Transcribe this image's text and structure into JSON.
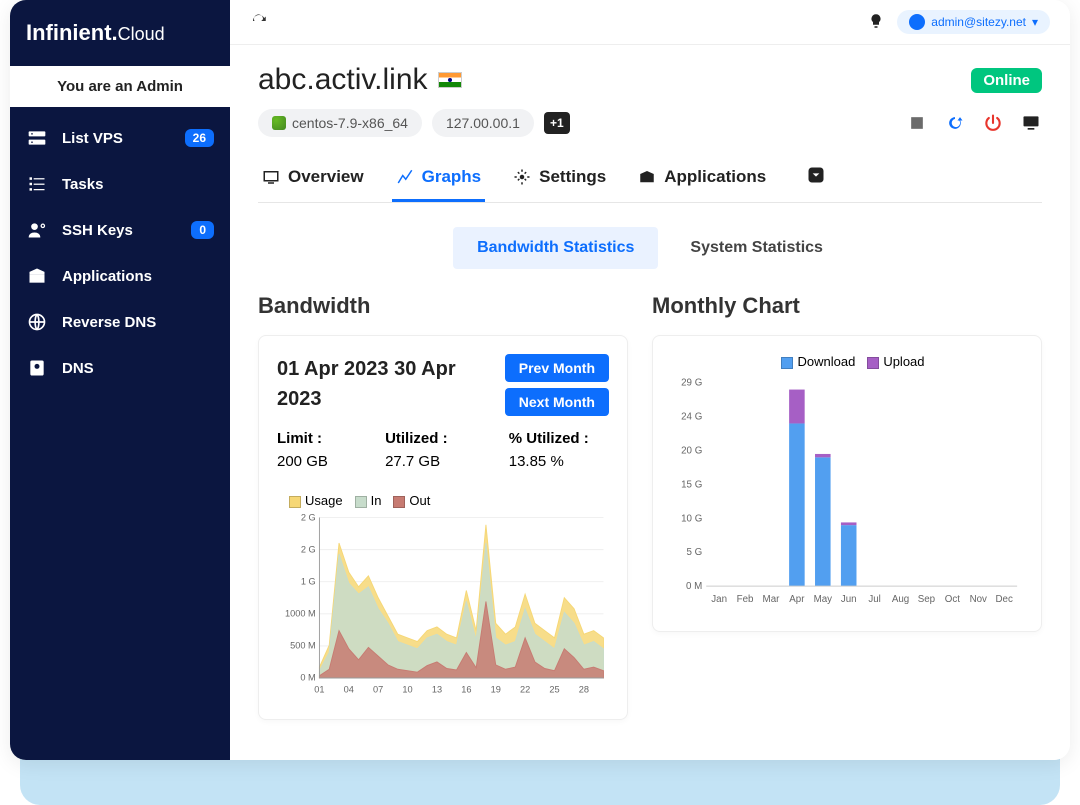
{
  "brand": {
    "main": "Infinient.",
    "sub": "Cloud"
  },
  "admin_banner": "You are an Admin",
  "sidebar": [
    {
      "label": "List VPS",
      "badge": "26"
    },
    {
      "label": "Tasks",
      "badge": null
    },
    {
      "label": "SSH Keys",
      "badge": "0"
    },
    {
      "label": "Applications",
      "badge": null
    },
    {
      "label": "Reverse DNS",
      "badge": null
    },
    {
      "label": "DNS",
      "badge": null
    }
  ],
  "user": "admin@sitezy.net",
  "vps": {
    "title": "abc.activ.link",
    "status": "Online",
    "os": "centos-7.9-x86_64",
    "ip": "127.00.00.1",
    "more_ips": "+1"
  },
  "tabs": [
    "Overview",
    "Graphs",
    "Settings",
    "Applications"
  ],
  "subtabs": [
    "Bandwidth Statistics",
    "System Statistics"
  ],
  "bandwidth": {
    "title": "Bandwidth",
    "period": "01 Apr 2023  30 Apr 2023",
    "prev_btn": "Prev Month",
    "next_btn": "Next Month",
    "limit_label": "Limit :",
    "limit_val": "200 GB",
    "util_label": "Utilized :",
    "util_val": "27.7 GB",
    "pct_label": "% Utilized :",
    "pct_val": "13.85 %"
  },
  "monthly": {
    "title": "Monthly Chart"
  },
  "chart_data": [
    {
      "type": "area",
      "title": "Bandwidth daily usage",
      "xlabel": "",
      "ylabel": "",
      "y_ticks": [
        "0 M",
        "500 M",
        "1000 M",
        "1 G",
        "2 G",
        "2 G"
      ],
      "x_ticks": [
        "01",
        "04",
        "07",
        "10",
        "13",
        "16",
        "19",
        "22",
        "25",
        "28"
      ],
      "categories": [
        1,
        2,
        3,
        4,
        5,
        6,
        7,
        8,
        9,
        10,
        11,
        12,
        13,
        14,
        15,
        16,
        17,
        18,
        19,
        20,
        21,
        22,
        23,
        24,
        25,
        26,
        27,
        28,
        29,
        30
      ],
      "series": [
        {
          "name": "Usage",
          "color": "#f6d775",
          "values": [
            150,
            450,
            1850,
            1450,
            1250,
            1400,
            1100,
            850,
            600,
            550,
            500,
            650,
            700,
            600,
            550,
            1200,
            650,
            2100,
            750,
            600,
            700,
            1150,
            750,
            650,
            550,
            1100,
            950,
            600,
            650,
            550
          ]
        },
        {
          "name": "In",
          "color": "#c7dccb",
          "values": [
            100,
            350,
            1700,
            1300,
            1150,
            1250,
            950,
            750,
            500,
            450,
            400,
            550,
            600,
            500,
            450,
            1050,
            520,
            1850,
            550,
            450,
            500,
            950,
            600,
            500,
            400,
            900,
            750,
            450,
            500,
            400
          ]
        },
        {
          "name": "Out",
          "color": "#c77b72",
          "values": [
            30,
            120,
            650,
            400,
            250,
            420,
            300,
            180,
            120,
            100,
            80,
            170,
            220,
            130,
            110,
            350,
            140,
            1050,
            180,
            120,
            150,
            550,
            220,
            130,
            100,
            400,
            280,
            120,
            150,
            100
          ]
        }
      ],
      "ylim": [
        0,
        2200
      ]
    },
    {
      "type": "bar",
      "title": "Monthly Chart",
      "xlabel": "",
      "ylabel": "",
      "y_ticks": [
        "0 M",
        "5 G",
        "10 G",
        "15 G",
        "20 G",
        "24 G",
        "29 G"
      ],
      "categories": [
        "Jan",
        "Feb",
        "Mar",
        "Apr",
        "May",
        "Jun",
        "Jul",
        "Aug",
        "Sep",
        "Oct",
        "Nov",
        "Dec"
      ],
      "series": [
        {
          "name": "Download",
          "color": "#529ff0",
          "values": [
            0,
            0,
            0,
            24,
            19,
            9,
            0,
            0,
            0,
            0,
            0,
            0
          ]
        },
        {
          "name": "Upload",
          "color": "#a65fc5",
          "values": [
            0,
            0,
            0,
            5,
            0.5,
            0.4,
            0,
            0,
            0,
            0,
            0,
            0
          ]
        }
      ],
      "ylim": [
        0,
        30
      ]
    }
  ]
}
